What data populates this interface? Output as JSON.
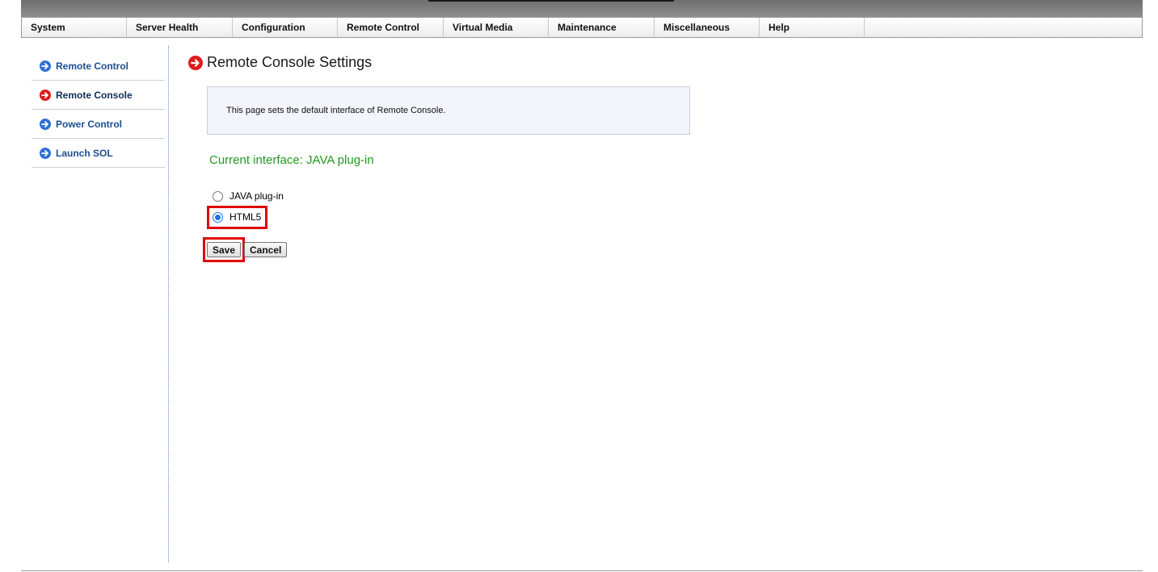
{
  "menubar": {
    "items": [
      "System",
      "Server Health",
      "Configuration",
      "Remote Control",
      "Virtual Media",
      "Maintenance",
      "Miscellaneous",
      "Help"
    ]
  },
  "sidebar": {
    "items": [
      {
        "label": "Remote Control",
        "icon": "arrow-right-circle-icon",
        "active": false
      },
      {
        "label": "Remote Console",
        "icon": "arrow-right-circle-icon",
        "active": true
      },
      {
        "label": "Power Control",
        "icon": "arrow-right-circle-icon",
        "active": false
      },
      {
        "label": "Launch SOL",
        "icon": "arrow-right-circle-icon",
        "active": false
      }
    ]
  },
  "main": {
    "title": "Remote Console Settings",
    "info": "This page sets the default interface of Remote Console.",
    "current_interface": "Current interface: JAVA plug-in",
    "options": [
      {
        "label": "JAVA plug-in",
        "checked": false
      },
      {
        "label": "HTML5",
        "checked": true
      }
    ],
    "save_label": "Save",
    "cancel_label": "Cancel"
  },
  "colors": {
    "accent_blue": "#2f6fd6",
    "accent_red": "#e01b1b",
    "status_green": "#1f9a1f",
    "highlight_red": "#e00000"
  }
}
